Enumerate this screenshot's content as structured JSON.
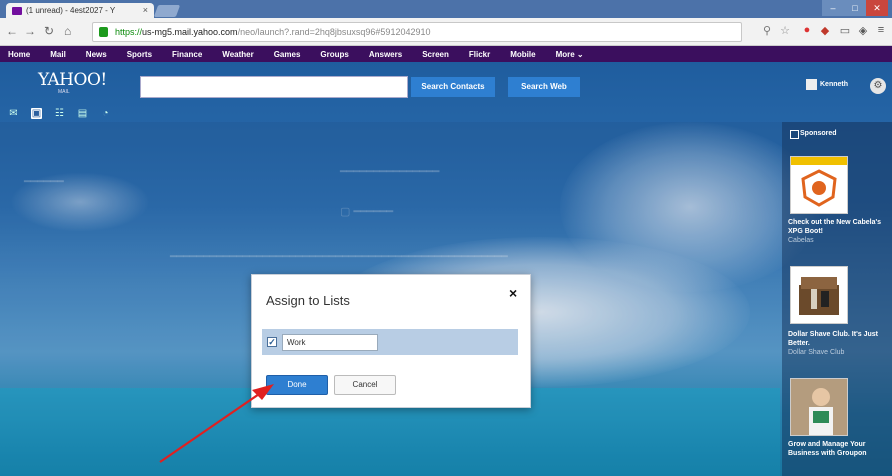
{
  "browser": {
    "tab_title": "(1 unread) - 4est2027 - Y",
    "tab_close": "×",
    "url_scheme": "https://",
    "url_host": "us-mg5.mail.yahoo.com",
    "url_path": "/neo/launch?.rand=2hq8jbsuxsq96#5912042910"
  },
  "yahoo_nav": [
    "Home",
    "Mail",
    "News",
    "Sports",
    "Finance",
    "Weather",
    "Games",
    "Groups",
    "Answers",
    "Screen",
    "Flickr",
    "Mobile",
    "More ⌄"
  ],
  "header": {
    "logo": "YAHOO!",
    "logo_sub": "MAIL",
    "search_contacts": "Search Contacts",
    "search_web": "Search Web",
    "user_name": "Kenneth"
  },
  "ads": {
    "header": "Sponsored",
    "items": [
      {
        "title": "Check out the New Cabela's XPG Boot!",
        "source": "Cabelas"
      },
      {
        "title": "Dollar Shave Club. It's Just Better.",
        "source": "Dollar Shave Club"
      },
      {
        "title": "Grow and Manage Your Business with Groupon",
        "source": ""
      }
    ]
  },
  "dialog": {
    "title": "Assign to Lists",
    "close": "×",
    "list_item": "Work",
    "checked": true,
    "done_label": "Done",
    "cancel_label": "Cancel"
  },
  "colors": {
    "yahoo_purple": "#3b0f5e",
    "accent_blue": "#2e7fd1",
    "annotation_red": "#e02020"
  }
}
